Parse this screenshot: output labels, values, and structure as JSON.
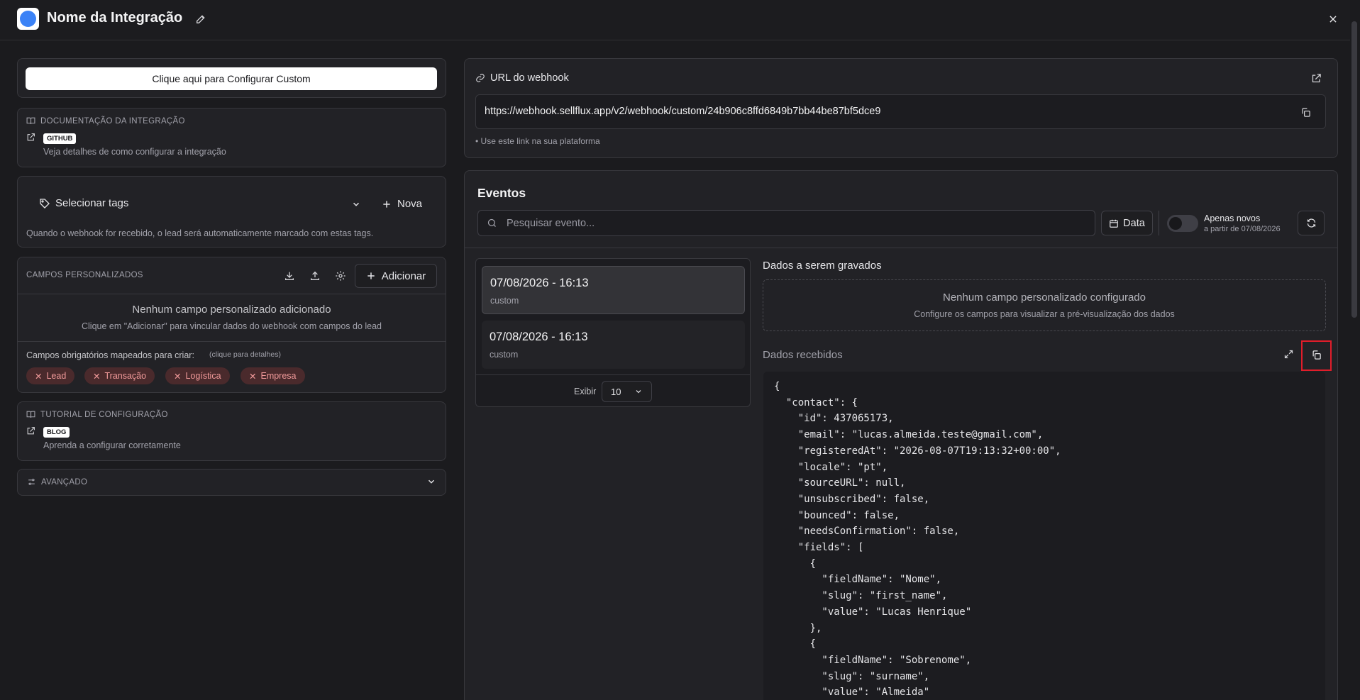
{
  "header": {
    "title": "Nome da Integração"
  },
  "left": {
    "config_button": "Clique aqui para Configurar Custom",
    "docs": {
      "title": "DOCUMENTAÇÃO DA INTEGRAÇÃO",
      "chip": "GITHUB",
      "description": "Veja detalhes de como configurar a integração"
    },
    "tags": {
      "select_label": "Selecionar tags",
      "new_label": "Nova",
      "hint": "Quando o webhook for recebido, o lead será automaticamente marcado com estas tags."
    },
    "custom_fields": {
      "title": "CAMPOS PERSONALIZADOS",
      "add_label": "Adicionar",
      "empty_title": "Nenhum campo personalizado adicionado",
      "empty_subtitle": "Clique em \"Adicionar\" para vincular dados do webhook com campos do lead",
      "required_label": "Campos obrigatórios mapeados para criar:",
      "required_hint": "(clique para detalhes)",
      "required_chips": [
        "Lead",
        "Transação",
        "Logística",
        "Empresa"
      ]
    },
    "tutorial": {
      "title": "TUTORIAL DE CONFIGURAÇÃO",
      "chip": "BLOG",
      "description": "Aprenda a configurar corretamente"
    },
    "advanced": {
      "title": "AVANÇADO"
    }
  },
  "webhook": {
    "label": "URL do webhook",
    "url": "https://webhook.sellflux.app/v2/webhook/custom/24b906c8ffd6849b7bb44be87bf5dce9",
    "hint": "• Use este link na sua plataforma"
  },
  "events": {
    "title": "Eventos",
    "search_placeholder": "Pesquisar evento...",
    "date_button": "Data",
    "toggle_label": "Apenas novos",
    "toggle_sub": "a partir de 07/08/2026",
    "items": [
      {
        "datetime": "07/08/2026 - 16:13",
        "type": "custom"
      },
      {
        "datetime": "07/08/2026 - 16:13",
        "type": "custom"
      }
    ],
    "show_label": "Exibir",
    "show_value": "10"
  },
  "data_panel": {
    "saved_title": "Dados a serem gravados",
    "saved_empty_title": "Nenhum campo personalizado configurado",
    "saved_empty_sub": "Configure os campos para visualizar a pré-visualização dos dados",
    "received_title": "Dados recebidos",
    "code_lines": [
      "{",
      "  \"contact\": {",
      "    \"id\": 437065173,",
      "    \"email\": \"lucas.almeida.teste@gmail.com\",",
      "    \"registeredAt\": \"2026-08-07T19:13:32+00:00\",",
      "    \"locale\": \"pt\",",
      "    \"sourceURL\": null,",
      "    \"unsubscribed\": false,",
      "    \"bounced\": false,",
      "    \"needsConfirmation\": false,",
      "    \"fields\": [",
      "      {",
      "        \"fieldName\": \"Nome\",",
      "        \"slug\": \"first_name\",",
      "        \"value\": \"Lucas Henrique\"",
      "      },",
      "      {",
      "        \"fieldName\": \"Sobrenome\",",
      "        \"slug\": \"surname\",",
      "        \"value\": \"Almeida\""
    ]
  }
}
